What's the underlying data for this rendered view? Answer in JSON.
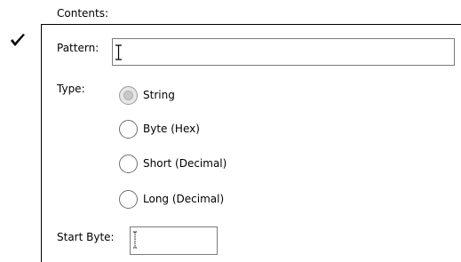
{
  "section": {
    "title": "Contents:",
    "enabled_checkbox": {
      "checked": true,
      "icon": "checkmark-icon"
    }
  },
  "pattern": {
    "label": "Pattern:",
    "value": ""
  },
  "type": {
    "label": "Type:",
    "options": [
      {
        "label": "String",
        "selected": true
      },
      {
        "label": "Byte (Hex)",
        "selected": false
      },
      {
        "label": "Short (Decimal)",
        "selected": false
      },
      {
        "label": "Long (Decimal)",
        "selected": false
      }
    ]
  },
  "start_byte": {
    "label": "Start Byte:",
    "value": ""
  },
  "colors": {
    "border": "#7a7a7a",
    "selected_radio_fill": "#c8c8c8"
  }
}
